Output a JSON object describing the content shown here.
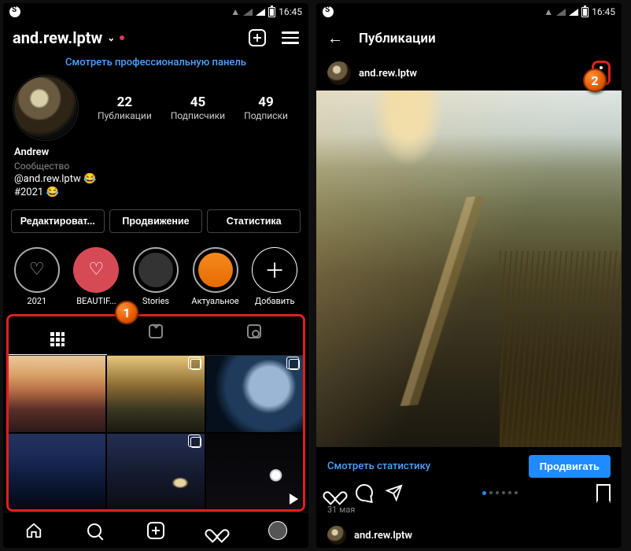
{
  "status": {
    "time": "16:45"
  },
  "left": {
    "username": "and.rew.lptw",
    "pro_panel": "Смотреть профессиональную панель",
    "stats": {
      "posts": {
        "num": "22",
        "label": "Публикации"
      },
      "followers": {
        "num": "45",
        "label": "Подписчики"
      },
      "following": {
        "num": "49",
        "label": "Подписки"
      }
    },
    "bio": {
      "name": "Andrew",
      "category": "Сообщество",
      "handle_line": "@and.rew.lptw 😂",
      "tag_line": "#2021 😂"
    },
    "buttons": {
      "edit": "Редактироват...",
      "promote": "Продвижение",
      "stats": "Статистика"
    },
    "highlights": {
      "h1": "2021",
      "h2": "BEAUTIF...",
      "h3": "Stories",
      "h4": "Актуальное",
      "add": "Добавить"
    }
  },
  "right": {
    "title": "Публикации",
    "post_user": "and.rew.lptw",
    "view_stats": "Смотреть статистику",
    "promote": "Продвигать",
    "date": "31 мая",
    "next_user": "and.rew.lptw"
  },
  "markers": {
    "one": "1",
    "two": "2"
  }
}
